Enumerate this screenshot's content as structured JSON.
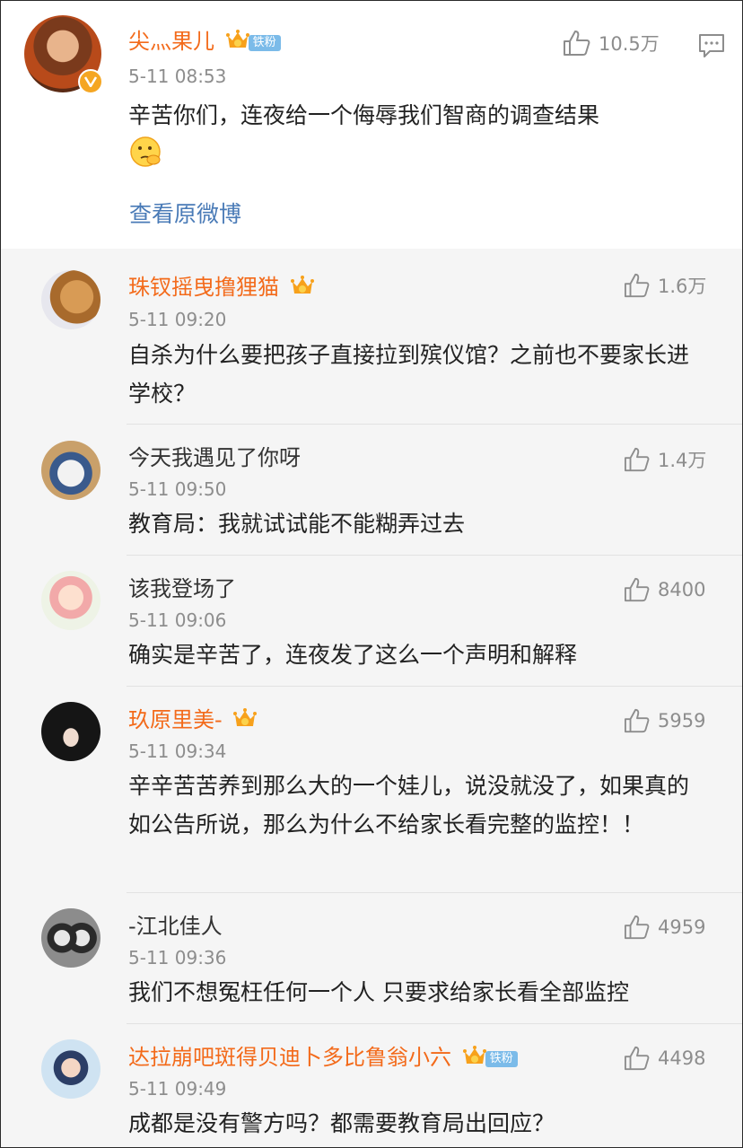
{
  "main_post": {
    "username": "尖灬果儿",
    "fan_badge": "铁粉",
    "time": "5-11 08:53",
    "likes": "10.5万",
    "text": "辛苦你们，连夜给一个侮辱我们智商的调查结果",
    "emoji": "thinking-emoji",
    "view_original": "查看原微博"
  },
  "comments": [
    {
      "username": "珠钗摇曳撸狸猫",
      "vip": true,
      "fan_badge": "",
      "time": "5-11 09:20",
      "likes": "1.6万",
      "text": "自杀为什么要把孩子直接拉到殡仪馆？之前也不要家长进学校？"
    },
    {
      "username": "今天我遇见了你呀",
      "vip": false,
      "fan_badge": "",
      "time": "5-11 09:50",
      "likes": "1.4万",
      "text": "教育局：我就试试能不能糊弄过去"
    },
    {
      "username": "该我登场了",
      "vip": false,
      "fan_badge": "",
      "time": "5-11 09:06",
      "likes": "8400",
      "text": "确实是辛苦了，连夜发了这么一个声明和解释"
    },
    {
      "username": "玖原里美-",
      "vip": true,
      "fan_badge": "",
      "time": "5-11 09:34",
      "likes": "5959",
      "text": "辛辛苦苦养到那么大的一个娃儿，说没就没了，如果真的如公告所说，那么为什么不给家长看完整的监控！！"
    },
    {
      "username": "-江北佳人",
      "vip": false,
      "fan_badge": "",
      "time": "5-11 09:36",
      "likes": "4959",
      "text": "我们不想冤枉任何一个人 只要求给家长看全部监控"
    },
    {
      "username": "达拉崩吧斑得贝迪卜多比鲁翁小六",
      "vip": true,
      "fan_badge": "铁粉",
      "time": "5-11 09:49",
      "likes": "4498",
      "text": "成都是没有警方吗？都需要教育局出回应？"
    }
  ],
  "colors": {
    "vip_name": "#f36a1a",
    "normal_name": "#333333",
    "link": "#4a7bb7",
    "badge_bg": "#7bbbe9"
  }
}
